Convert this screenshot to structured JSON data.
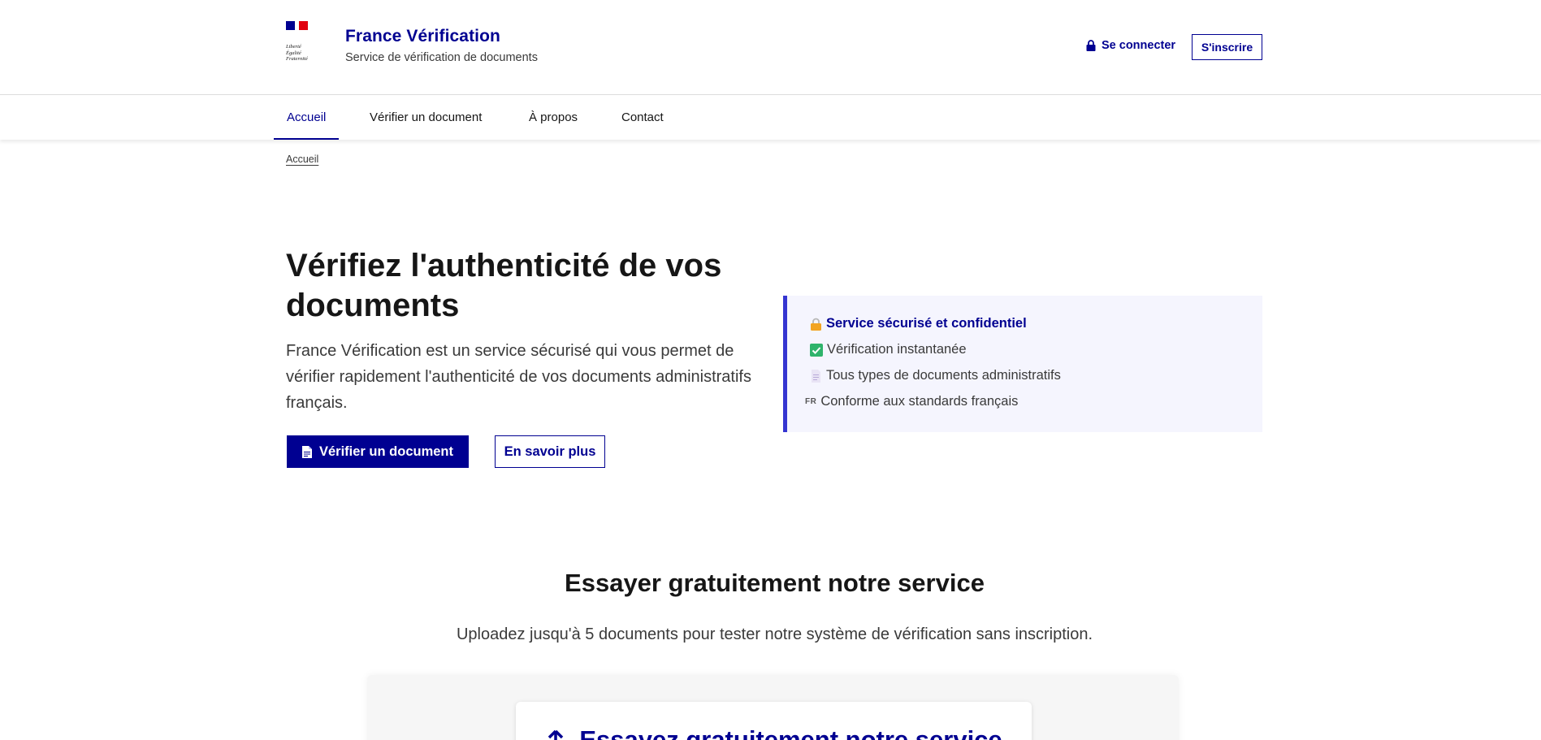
{
  "header": {
    "motto": [
      "Liberté",
      "Égalité",
      "Fraternité"
    ],
    "site_title": "France Vérification",
    "site_subtitle": "Service de vérification de documents",
    "login_label": "Se connecter",
    "signup_label": "S'inscrire"
  },
  "nav": {
    "items": [
      "Accueil",
      "Vérifier un document",
      "À propos",
      "Contact"
    ],
    "active": "Accueil"
  },
  "breadcrumb": "Accueil",
  "hero": {
    "title": "Vérifiez l'authenticité de vos documents",
    "lead": "France Vérification est un service sécurisé qui vous permet de vérifier rapidement l'authenticité de vos documents administratifs français.",
    "primary_button": "Vérifier un document",
    "secondary_button": "En savoir plus"
  },
  "callout": {
    "items": [
      {
        "icon": "padlock-icon",
        "tag": "",
        "text": "Service sécurisé et confidentiel"
      },
      {
        "icon": "check-icon",
        "tag": "",
        "text": "Vérification instantanée"
      },
      {
        "icon": "document-icon",
        "tag": "",
        "text": "Tous types de documents administratifs"
      },
      {
        "icon": "fr-flag-icon",
        "tag": "FR",
        "text": "Conforme aux standards français"
      }
    ]
  },
  "trial": {
    "title": "Essayer gratuitement notre service",
    "subtitle": "Uploadez jusqu'à 5 documents pour tester notre système de vérification sans inscription.",
    "card_title": "Essayez gratuitement notre service"
  },
  "colors": {
    "brand_blue": "#000091",
    "marianne_red": "#e1000f",
    "callout_border": "#3535d1",
    "callout_bg": "#f5f5fe"
  }
}
